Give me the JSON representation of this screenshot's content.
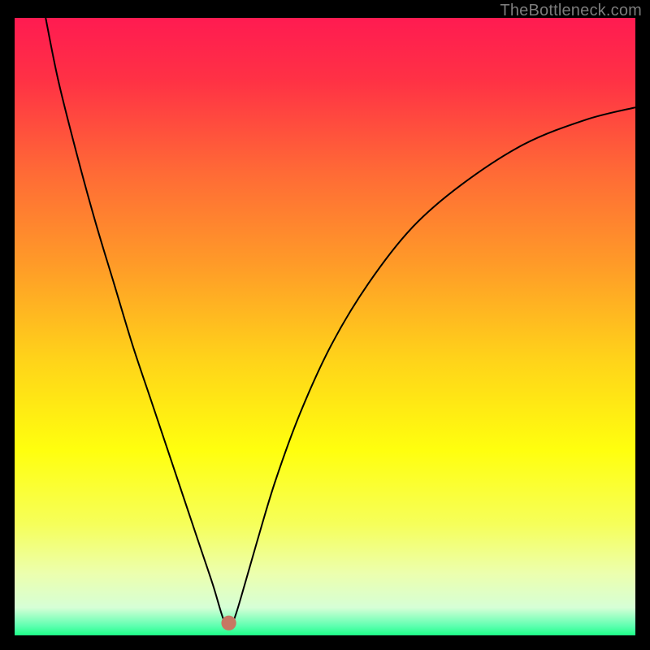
{
  "watermark": "TheBottleneck.com",
  "chart_data": {
    "type": "line",
    "title": "",
    "xlabel": "",
    "ylabel": "",
    "xlim": [
      0,
      100
    ],
    "ylim": [
      0,
      100
    ],
    "legend": false,
    "annotations": [],
    "tick_labels_x": [],
    "tick_labels_y": [],
    "background_gradient_stops": [
      {
        "pos": 0.0,
        "color": "#ff1b51"
      },
      {
        "pos": 0.1,
        "color": "#ff3145"
      },
      {
        "pos": 0.25,
        "color": "#ff6a36"
      },
      {
        "pos": 0.4,
        "color": "#ff9b28"
      },
      {
        "pos": 0.55,
        "color": "#ffd21a"
      },
      {
        "pos": 0.7,
        "color": "#ffff0e"
      },
      {
        "pos": 0.82,
        "color": "#f6ff5a"
      },
      {
        "pos": 0.9,
        "color": "#ecffae"
      },
      {
        "pos": 0.955,
        "color": "#d6ffd6"
      },
      {
        "pos": 0.985,
        "color": "#5dffb0"
      },
      {
        "pos": 1.0,
        "color": "#1dff87"
      }
    ],
    "marker": {
      "x": 34.5,
      "y": 2,
      "color": "#c77763",
      "r": 1.2
    },
    "series": [
      {
        "name": "curve",
        "points": [
          {
            "x": 5.0,
            "y": 100.0
          },
          {
            "x": 7.0,
            "y": 90.0
          },
          {
            "x": 10.0,
            "y": 78.0
          },
          {
            "x": 13.0,
            "y": 67.0
          },
          {
            "x": 16.0,
            "y": 57.0
          },
          {
            "x": 19.0,
            "y": 47.0
          },
          {
            "x": 22.0,
            "y": 38.0
          },
          {
            "x": 25.0,
            "y": 29.0
          },
          {
            "x": 28.0,
            "y": 20.0
          },
          {
            "x": 30.0,
            "y": 14.0
          },
          {
            "x": 32.0,
            "y": 8.0
          },
          {
            "x": 33.5,
            "y": 3.0
          },
          {
            "x": 34.5,
            "y": 1.0
          },
          {
            "x": 35.5,
            "y": 3.0
          },
          {
            "x": 37.0,
            "y": 8.0
          },
          {
            "x": 39.0,
            "y": 15.0
          },
          {
            "x": 42.0,
            "y": 25.0
          },
          {
            "x": 46.0,
            "y": 36.0
          },
          {
            "x": 51.0,
            "y": 47.0
          },
          {
            "x": 57.0,
            "y": 57.0
          },
          {
            "x": 64.0,
            "y": 66.0
          },
          {
            "x": 72.0,
            "y": 73.0
          },
          {
            "x": 82.0,
            "y": 79.5
          },
          {
            "x": 92.0,
            "y": 83.5
          },
          {
            "x": 100.0,
            "y": 85.5
          }
        ]
      }
    ]
  }
}
